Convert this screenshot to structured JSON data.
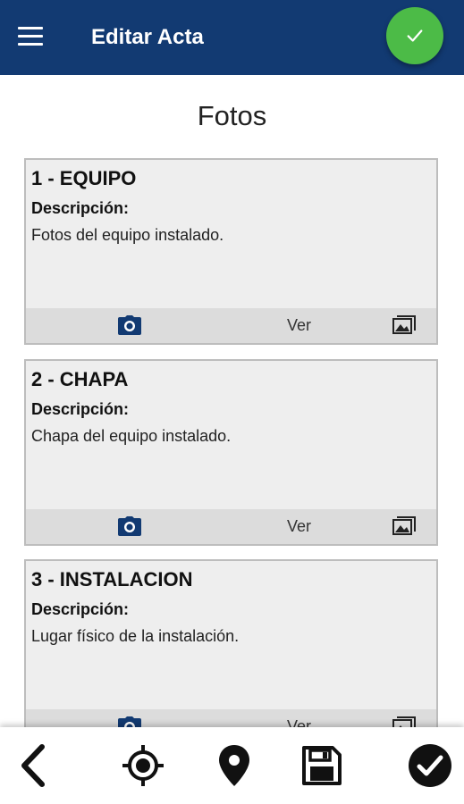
{
  "appbar": {
    "title": "Editar Acta",
    "menu_icon": "menu-icon",
    "confirm_icon": "check-icon",
    "fab_color": "#4cbb47",
    "bar_color": "#123a72"
  },
  "page": {
    "title": "Fotos"
  },
  "cards": [
    {
      "title": "1 - EQUIPO",
      "desc_label": "Descripción:",
      "desc": "Fotos del equipo instalado.",
      "view_label": "Ver"
    },
    {
      "title": "2 - CHAPA",
      "desc_label": "Descripción:",
      "desc": "Chapa del equipo instalado.",
      "view_label": "Ver"
    },
    {
      "title": "3 - INSTALACION",
      "desc_label": "Descripción:",
      "desc": "Lugar físico de la instalación.",
      "view_label": "Ver"
    }
  ],
  "bottombar": {
    "icons": [
      "back-icon",
      "gps-target-icon",
      "location-pin-icon",
      "save-icon",
      "check-circle-icon"
    ]
  }
}
